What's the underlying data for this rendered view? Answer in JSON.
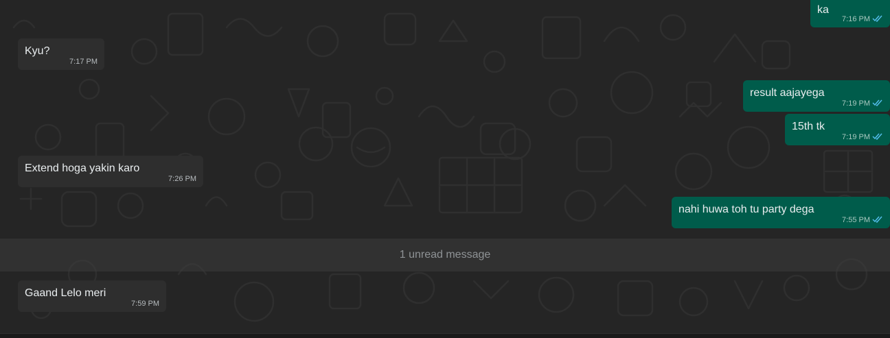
{
  "chat": {
    "colors": {
      "background": "#252525",
      "incoming_bubble": "#2e2e2e",
      "outgoing_bubble": "#005c4b",
      "read_tick": "#53bdeb"
    },
    "messages": [
      {
        "direction": "outgoing",
        "text": "ka",
        "time": "7:16 PM",
        "status": "read"
      },
      {
        "direction": "incoming",
        "text": "Kyu?",
        "time": "7:17 PM"
      },
      {
        "direction": "outgoing",
        "text": "result aajayega",
        "time": "7:19 PM",
        "status": "read"
      },
      {
        "direction": "outgoing",
        "text": "15th tk",
        "time": "7:19 PM",
        "status": "read"
      },
      {
        "direction": "incoming",
        "text": "Extend hoga yakin karo",
        "time": "7:26 PM"
      },
      {
        "direction": "outgoing",
        "text": "nahi huwa toh tu party dega",
        "time": "7:55 PM",
        "status": "read"
      },
      {
        "direction": "incoming",
        "text": "Gaand Lelo meri",
        "time": "7:59 PM"
      }
    ],
    "unread_divider": "1 unread message"
  }
}
